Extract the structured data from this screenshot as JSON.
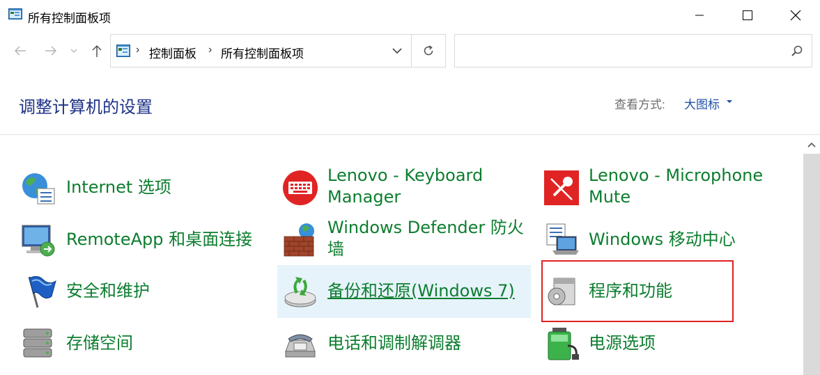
{
  "window": {
    "title": "所有控制面板项",
    "minimize_icon": "minimize-icon",
    "maximize_icon": "maximize-icon",
    "close_icon": "close-icon"
  },
  "nav": {
    "breadcrumbs": [
      "控制面板",
      "所有控制面板项"
    ],
    "search_placeholder": ""
  },
  "header": {
    "title": "调整计算机的设置",
    "view_label": "查看方式:",
    "view_value": "大图标"
  },
  "items": [
    {
      "label": "Internet 选项",
      "icon": "globe-options-icon"
    },
    {
      "label": "Lenovo - Keyboard Manager",
      "line1": "Lenovo - Keyboard",
      "line2": "Manager",
      "icon": "keyboard-icon"
    },
    {
      "label": "Lenovo - Microphone Mute",
      "line1": "Lenovo - Microphone",
      "line2": "Mute",
      "icon": "microphone-mute-icon"
    },
    {
      "label": "RemoteApp 和桌面连接",
      "icon": "remote-desktop-icon"
    },
    {
      "label": "Windows Defender 防火墙",
      "line1": "Windows Defender 防火",
      "line2": "墙",
      "icon": "firewall-icon"
    },
    {
      "label": "Windows 移动中心",
      "icon": "mobility-center-icon"
    },
    {
      "label": "安全和维护",
      "icon": "flag-icon"
    },
    {
      "label": "备份和还原(Windows 7)",
      "icon": "backup-icon"
    },
    {
      "label": "程序和功能",
      "icon": "programs-icon"
    },
    {
      "label": "存储空间",
      "icon": "storage-icon"
    },
    {
      "label": "电话和调制解调器",
      "icon": "phone-modem-icon"
    },
    {
      "label": "电源选项",
      "icon": "power-options-icon"
    }
  ],
  "colors": {
    "link_green": "#0d7d2f",
    "title_blue": "#1e3287",
    "view_blue": "#1f4fa5",
    "hover_bg": "#e6f3fb",
    "highlight_red": "#e02020"
  }
}
